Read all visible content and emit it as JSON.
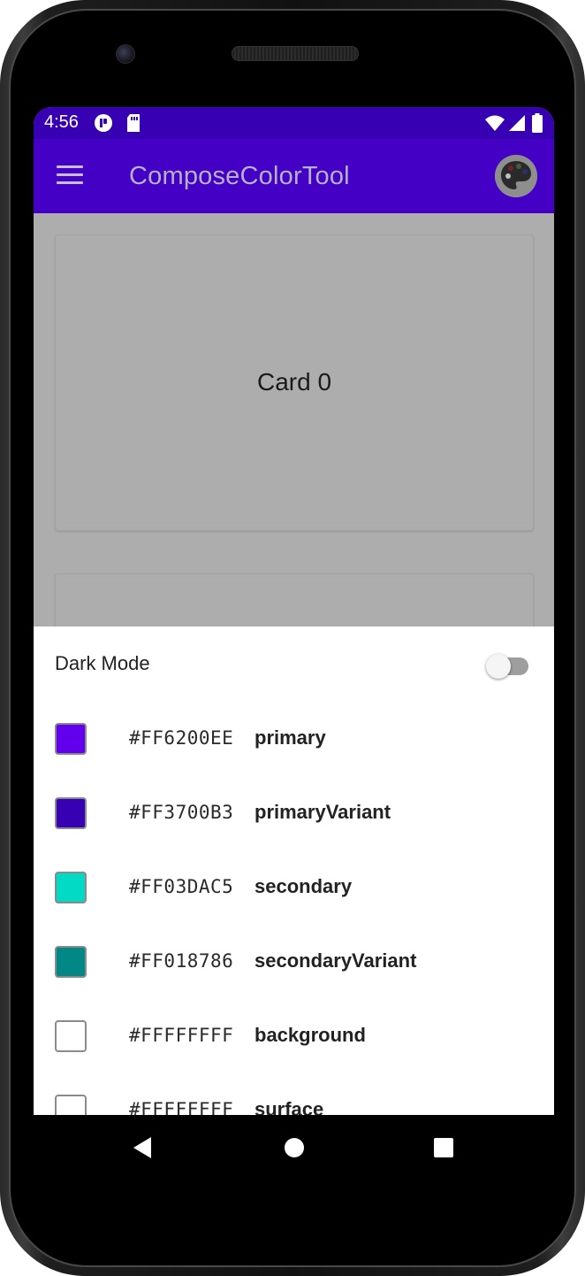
{
  "status_bar": {
    "time": "4:56",
    "icons": [
      "notification-app-icon",
      "sd-card-icon",
      "wifi-icon",
      "cell-signal-icon",
      "battery-icon"
    ]
  },
  "app_bar": {
    "title": "ComposeColorTool",
    "menu_icon": "menu-icon",
    "palette_icon": "palette-icon",
    "background": "#3700B3"
  },
  "cards": [
    {
      "label": "Card 0"
    },
    {
      "label": ""
    }
  ],
  "sheet": {
    "dark_mode_label": "Dark Mode",
    "dark_mode_on": false,
    "colors": [
      {
        "swatch": "#6200EE",
        "hex": "#FF6200EE",
        "name": "primary"
      },
      {
        "swatch": "#3700B3",
        "hex": "#FF3700B3",
        "name": "primaryVariant"
      },
      {
        "swatch": "#03DAC5",
        "hex": "#FF03DAC5",
        "name": "secondary"
      },
      {
        "swatch": "#018786",
        "hex": "#FF018786",
        "name": "secondaryVariant"
      },
      {
        "swatch": "#FFFFFF",
        "hex": "#FFFFFFFF",
        "name": "background"
      },
      {
        "swatch": "#FFFFFF",
        "hex": "#FFFFFFFF",
        "name": "surface"
      }
    ]
  },
  "nav_bar": {
    "icons": [
      "back-icon",
      "home-icon",
      "recents-icon"
    ]
  }
}
